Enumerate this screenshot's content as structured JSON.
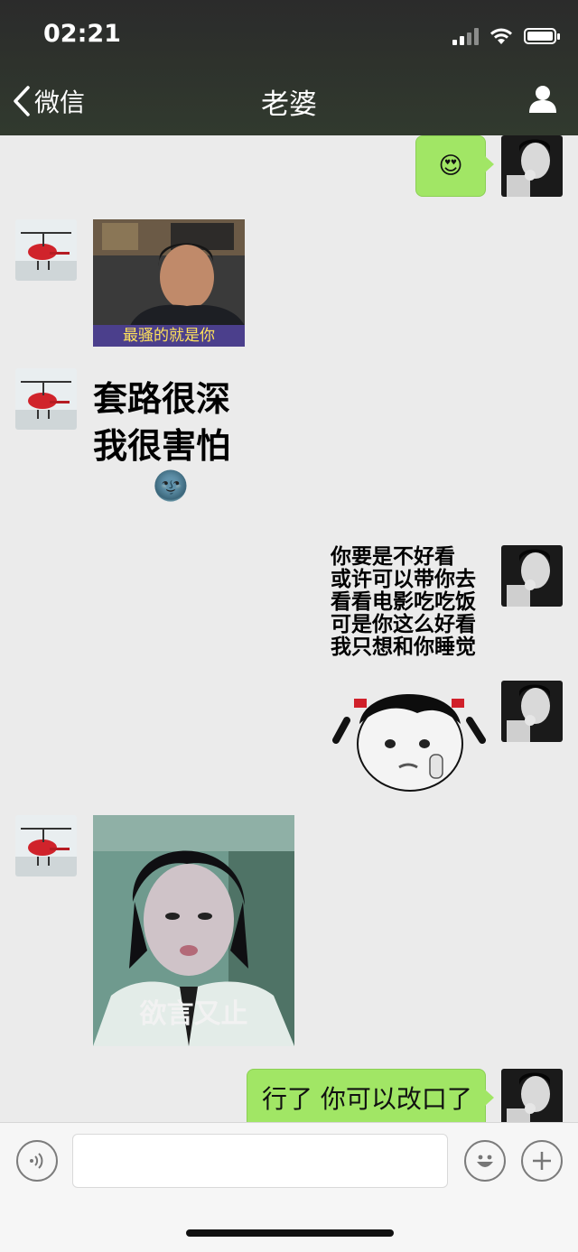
{
  "status_bar": {
    "time": "02:21"
  },
  "header": {
    "back_label": "微信",
    "title": "老婆"
  },
  "messages": [
    {
      "side": "right",
      "type": "emoji",
      "emoji": "😍"
    },
    {
      "side": "left",
      "type": "sticker",
      "caption": "最骚的就是你"
    },
    {
      "side": "left",
      "type": "sticker",
      "lines": [
        "套路很深",
        "我很害怕"
      ],
      "emoji": "🌚"
    },
    {
      "side": "right",
      "type": "sticker",
      "lines": [
        "你要是不好看",
        "或许可以带你去",
        "看看电影吃吃饭",
        "可是你这么好看",
        "我只想和你睡觉"
      ]
    },
    {
      "side": "right",
      "type": "sticker",
      "caption": ""
    },
    {
      "side": "left",
      "type": "sticker",
      "caption": "欲言又止"
    },
    {
      "side": "right",
      "type": "text",
      "text": "行了 你可以改口了"
    }
  ],
  "colors": {
    "accent_green": "#a1e665",
    "chat_bg": "#ebebeb",
    "header_bg": "#2f342c"
  }
}
